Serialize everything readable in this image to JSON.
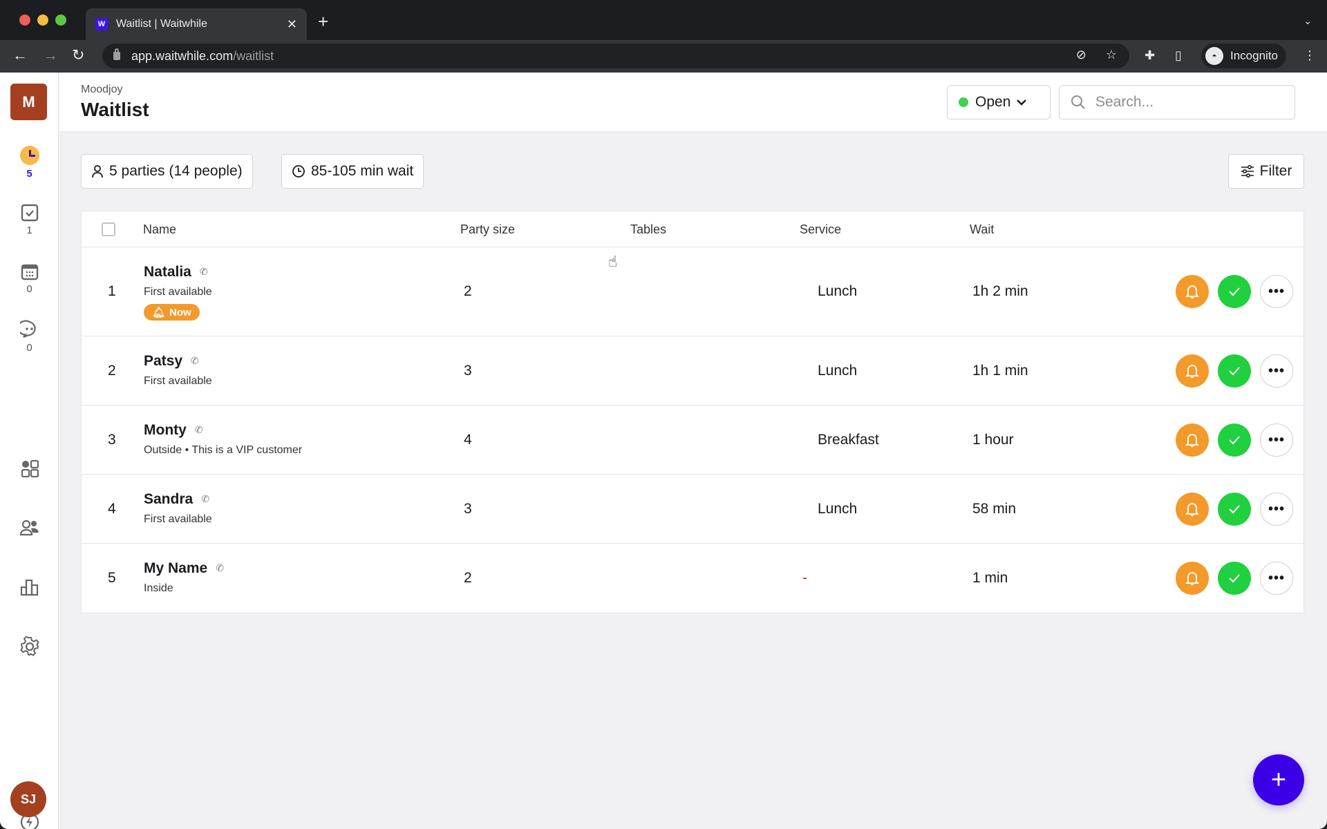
{
  "browser": {
    "tab_title": "Waitlist | Waitwhile",
    "favicon_letter": "W",
    "url_host": "app.waitwhile.com",
    "url_path": "/waitlist",
    "profile_label": "Incognito",
    "icons": [
      "back-arrow-icon",
      "forward-arrow-icon",
      "reload-icon",
      "lock-icon",
      "eye-slash-icon",
      "star-icon",
      "puzzle-icon",
      "sidepanel-icon",
      "incognito-icon",
      "kebab-menu-icon"
    ]
  },
  "sidebar": {
    "org_initial": "M",
    "items": [
      {
        "name": "waitlist",
        "icon": "clock-icon",
        "count": "5",
        "active": true
      },
      {
        "name": "serving",
        "icon": "check-square-icon",
        "count": "1"
      },
      {
        "name": "bookings",
        "icon": "calendar-icon",
        "count": "0"
      },
      {
        "name": "messages",
        "icon": "chat-icon",
        "count": "0"
      },
      {
        "name": "apps",
        "icon": "grid-icon"
      },
      {
        "name": "customers",
        "icon": "users-icon"
      },
      {
        "name": "analytics",
        "icon": "bar-chart-icon"
      },
      {
        "name": "settings",
        "icon": "gear-icon"
      }
    ],
    "bolt_icon": "lightning-icon",
    "user_initials": "SJ"
  },
  "header": {
    "org_name": "Moodjoy",
    "title": "Waitlist",
    "status": {
      "label": "Open",
      "color": "#3fd14f"
    },
    "search": {
      "placeholder": "Search...",
      "value": ""
    }
  },
  "stats": {
    "parties": "5 parties (14 people)",
    "wait": "85-105 min wait",
    "filter_label": "Filter"
  },
  "table": {
    "columns": [
      "Name",
      "Party size",
      "Tables",
      "Service",
      "Wait"
    ],
    "rows": [
      {
        "position": "1",
        "name": "Natalia",
        "note": "First available",
        "badge": "Now",
        "party_size": "2",
        "tables": "",
        "service": "Lunch",
        "wait": "1h 2 min"
      },
      {
        "position": "2",
        "name": "Patsy",
        "note": "First available",
        "party_size": "3",
        "tables": "",
        "service": "Lunch",
        "wait": "1h 1 min"
      },
      {
        "position": "3",
        "name": "Monty",
        "note": "Outside  • This is a VIP customer",
        "party_size": "4",
        "tables": "",
        "service": "Breakfast",
        "wait": "1 hour"
      },
      {
        "position": "4",
        "name": "Sandra",
        "note": "First available",
        "party_size": "3",
        "tables": "",
        "service": "Lunch",
        "wait": "58 min"
      },
      {
        "position": "5",
        "name": "My Name",
        "note": "Inside",
        "party_size": "2",
        "tables": "",
        "service": "-",
        "wait": "1 min"
      }
    ]
  },
  "colors": {
    "brand": "#3c00e6",
    "notify": "#f39a2b",
    "serve": "#20d03f",
    "org_badge": "#a4401f"
  },
  "fab_label": "+"
}
